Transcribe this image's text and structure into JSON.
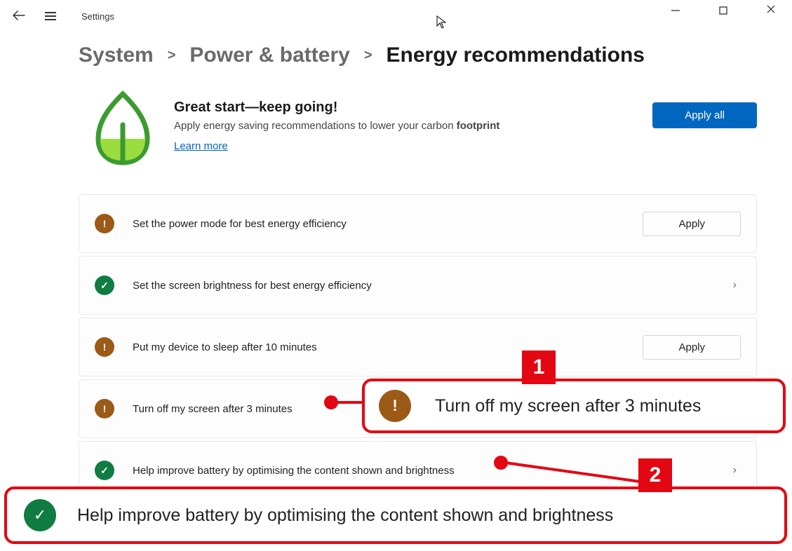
{
  "app": {
    "title": "Settings"
  },
  "breadcrumb": {
    "items": [
      {
        "label": "System"
      },
      {
        "label": "Power & battery"
      },
      {
        "label": "Energy recommendations"
      }
    ],
    "separator": ">"
  },
  "hero": {
    "title": "Great start—keep going!",
    "subtitle_prefix": "Apply energy saving recommendations to lower your carbon ",
    "subtitle_bold": "footprint",
    "learn_more": "Learn more",
    "apply_all": "Apply all"
  },
  "recommendations": [
    {
      "status": "warn",
      "label": "Set the power mode for best energy efficiency",
      "action": "apply",
      "apply_label": "Apply"
    },
    {
      "status": "ok",
      "label": "Set the screen brightness for best energy efficiency",
      "action": "chevron"
    },
    {
      "status": "warn",
      "label": "Put my device to sleep after 10 minutes",
      "action": "apply",
      "apply_label": "Apply"
    },
    {
      "status": "warn",
      "label": "Turn off my screen after 3 minutes",
      "action": "none"
    },
    {
      "status": "ok",
      "label": "Help improve battery by optimising the content shown and brightness",
      "action": "chevron"
    }
  ],
  "callouts": {
    "c1": {
      "number": "1",
      "text": "Turn off my screen after 3 minutes"
    },
    "c2": {
      "number": "2",
      "text": "Help improve battery by optimising the content shown and brightness"
    }
  },
  "icons": {
    "warn_glyph": "!",
    "ok_glyph": "✓",
    "chevron_right": "›"
  }
}
